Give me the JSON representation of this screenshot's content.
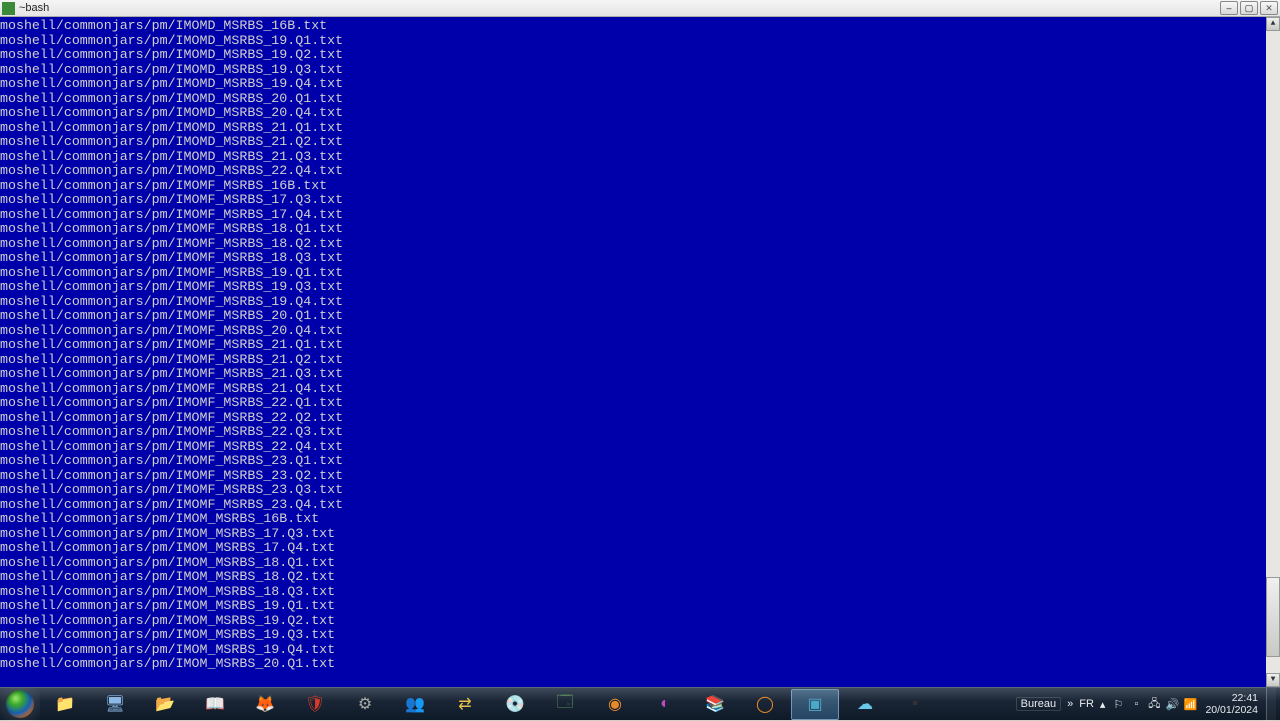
{
  "window": {
    "title": "~bash",
    "min_label": "–",
    "max_label": "▢",
    "close_label": "✕"
  },
  "terminal": {
    "lines": [
      "moshell/commonjars/pm/IMOMD_MSRBS_16B.txt",
      "moshell/commonjars/pm/IMOMD_MSRBS_19.Q1.txt",
      "moshell/commonjars/pm/IMOMD_MSRBS_19.Q2.txt",
      "moshell/commonjars/pm/IMOMD_MSRBS_19.Q3.txt",
      "moshell/commonjars/pm/IMOMD_MSRBS_19.Q4.txt",
      "moshell/commonjars/pm/IMOMD_MSRBS_20.Q1.txt",
      "moshell/commonjars/pm/IMOMD_MSRBS_20.Q4.txt",
      "moshell/commonjars/pm/IMOMD_MSRBS_21.Q1.txt",
      "moshell/commonjars/pm/IMOMD_MSRBS_21.Q2.txt",
      "moshell/commonjars/pm/IMOMD_MSRBS_21.Q3.txt",
      "moshell/commonjars/pm/IMOMD_MSRBS_22.Q4.txt",
      "moshell/commonjars/pm/IMOMF_MSRBS_16B.txt",
      "moshell/commonjars/pm/IMOMF_MSRBS_17.Q3.txt",
      "moshell/commonjars/pm/IMOMF_MSRBS_17.Q4.txt",
      "moshell/commonjars/pm/IMOMF_MSRBS_18.Q1.txt",
      "moshell/commonjars/pm/IMOMF_MSRBS_18.Q2.txt",
      "moshell/commonjars/pm/IMOMF_MSRBS_18.Q3.txt",
      "moshell/commonjars/pm/IMOMF_MSRBS_19.Q1.txt",
      "moshell/commonjars/pm/IMOMF_MSRBS_19.Q3.txt",
      "moshell/commonjars/pm/IMOMF_MSRBS_19.Q4.txt",
      "moshell/commonjars/pm/IMOMF_MSRBS_20.Q1.txt",
      "moshell/commonjars/pm/IMOMF_MSRBS_20.Q4.txt",
      "moshell/commonjars/pm/IMOMF_MSRBS_21.Q1.txt",
      "moshell/commonjars/pm/IMOMF_MSRBS_21.Q2.txt",
      "moshell/commonjars/pm/IMOMF_MSRBS_21.Q3.txt",
      "moshell/commonjars/pm/IMOMF_MSRBS_21.Q4.txt",
      "moshell/commonjars/pm/IMOMF_MSRBS_22.Q1.txt",
      "moshell/commonjars/pm/IMOMF_MSRBS_22.Q2.txt",
      "moshell/commonjars/pm/IMOMF_MSRBS_22.Q3.txt",
      "moshell/commonjars/pm/IMOMF_MSRBS_22.Q4.txt",
      "moshell/commonjars/pm/IMOMF_MSRBS_23.Q1.txt",
      "moshell/commonjars/pm/IMOMF_MSRBS_23.Q2.txt",
      "moshell/commonjars/pm/IMOMF_MSRBS_23.Q3.txt",
      "moshell/commonjars/pm/IMOMF_MSRBS_23.Q4.txt",
      "moshell/commonjars/pm/IMOM_MSRBS_16B.txt",
      "moshell/commonjars/pm/IMOM_MSRBS_17.Q3.txt",
      "moshell/commonjars/pm/IMOM_MSRBS_17.Q4.txt",
      "moshell/commonjars/pm/IMOM_MSRBS_18.Q1.txt",
      "moshell/commonjars/pm/IMOM_MSRBS_18.Q2.txt",
      "moshell/commonjars/pm/IMOM_MSRBS_18.Q3.txt",
      "moshell/commonjars/pm/IMOM_MSRBS_19.Q1.txt",
      "moshell/commonjars/pm/IMOM_MSRBS_19.Q2.txt",
      "moshell/commonjars/pm/IMOM_MSRBS_19.Q3.txt",
      "moshell/commonjars/pm/IMOM_MSRBS_19.Q4.txt",
      "moshell/commonjars/pm/IMOM_MSRBS_20.Q1.txt"
    ]
  },
  "taskbar": {
    "items": [
      {
        "name": "explorer-folder",
        "glyph": "📁",
        "color": "#f2c562"
      },
      {
        "name": "computer-app",
        "glyph": "🖥",
        "color": "#8bb8e8"
      },
      {
        "name": "documents-app",
        "glyph": "📂",
        "color": "#f2c562"
      },
      {
        "name": "reader-app",
        "glyph": "📖",
        "color": "#444"
      },
      {
        "name": "firefox",
        "glyph": "🦊",
        "color": "#ff7a18"
      },
      {
        "name": "security-app",
        "glyph": "🛡",
        "color": "#d83a2a"
      },
      {
        "name": "tool-app",
        "glyph": "⚙",
        "color": "#aaa"
      },
      {
        "name": "teams-app",
        "glyph": "👥",
        "color": "#6aa0d8"
      },
      {
        "name": "ftp-app",
        "glyph": "⇄",
        "color": "#e8c04a"
      },
      {
        "name": "burn-app",
        "glyph": "💿",
        "color": "#4a6ad8"
      },
      {
        "name": "calc-app",
        "glyph": "🗔",
        "color": "#5a8a5a"
      },
      {
        "name": "disc-app",
        "glyph": "◉",
        "color": "#e88a2a"
      },
      {
        "name": "edge-app",
        "glyph": "◐",
        "color": "#c048c0"
      },
      {
        "name": "archive-app",
        "glyph": "📚",
        "color": "#a8684a"
      },
      {
        "name": "media-app",
        "glyph": "◯",
        "color": "#e88a2a"
      },
      {
        "name": "terminal-app",
        "glyph": "▣",
        "color": "#4aa8c8",
        "active": true
      },
      {
        "name": "cloud-app",
        "glyph": "☁",
        "color": "#6ac8e8"
      },
      {
        "name": "cmd-app",
        "glyph": "▪",
        "color": "#333"
      }
    ],
    "bureau_label": "Bureau",
    "lang": "FR",
    "clock_time": "22:41",
    "clock_date": "20/01/2024"
  }
}
